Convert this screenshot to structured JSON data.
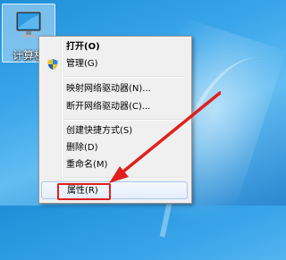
{
  "desktop": {
    "icon_label": "计算机"
  },
  "context_menu": {
    "items": [
      {
        "label": "打开(O)",
        "bold": true
      },
      {
        "label": "管理(G)",
        "icon": "uac-shield-icon"
      },
      {
        "label": "映射网络驱动器(N)..."
      },
      {
        "label": "断开网络驱动器(C)..."
      },
      {
        "label": "创建快捷方式(S)"
      },
      {
        "label": "删除(D)"
      },
      {
        "label": "重命名(M)"
      },
      {
        "label": "属性(R)",
        "highlighted": true
      }
    ]
  },
  "annotation": {
    "color": "#e0201c"
  }
}
